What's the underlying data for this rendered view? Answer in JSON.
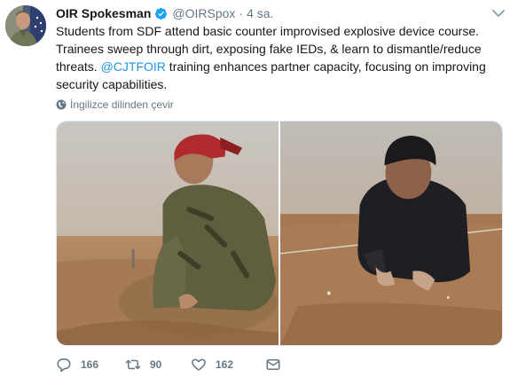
{
  "tweet": {
    "display_name": "OIR Spokesman",
    "handle": "@OIRSpox",
    "separator": "·",
    "time": "4 sa.",
    "text_before": "Students from SDF attend basic counter improvised explosive device course. Trainees sweep through dirt, exposing fake IEDs, & learn to dismantle/reduce threats. ",
    "mention": "@CJTFOIR",
    "text_after": " training enhances partner capacity, focusing on improving security capabilities.",
    "translate_label": "İngilizce dilinden çevir"
  },
  "actions": {
    "reply_count": "166",
    "retweet_count": "90",
    "like_count": "162"
  },
  "icons": {
    "verified": "verified-badge-icon",
    "caret": "chevron-down-icon",
    "globe": "globe-icon",
    "reply": "reply-icon",
    "retweet": "retweet-icon",
    "like": "heart-icon",
    "message": "envelope-icon"
  },
  "colors": {
    "link": "#1b95e0",
    "text": "#14171a",
    "muted": "#657786",
    "verified": "#1da1f2"
  }
}
